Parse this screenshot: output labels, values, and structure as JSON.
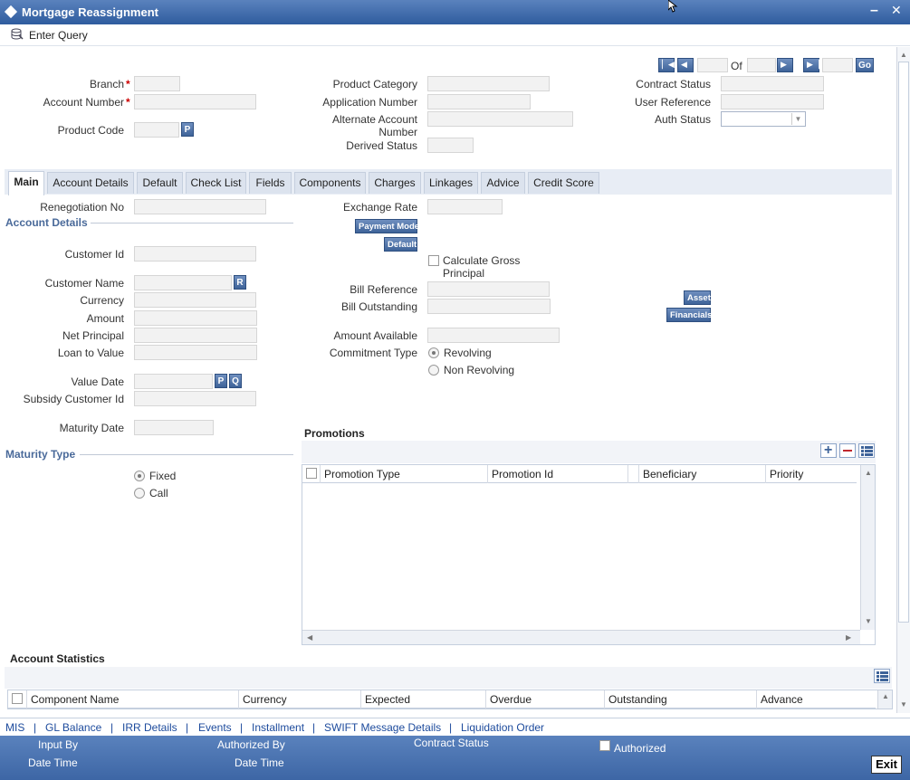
{
  "window": {
    "title": "Mortgage Reassignment",
    "minimize": "–",
    "close": "✕"
  },
  "toolbar": {
    "enter_query": "Enter Query"
  },
  "header": {
    "branch_label": "Branch",
    "account_number_label": "Account Number",
    "product_code_label": "Product Code",
    "product_category_label": "Product Category",
    "application_number_label": "Application Number",
    "alternate_account_label_1": "Alternate Account",
    "alternate_account_label_2": "Number",
    "derived_status_label": "Derived Status",
    "contract_status_label": "Contract Status",
    "user_reference_label": "User Reference",
    "auth_status_label": "Auth Status",
    "nav_of": "Of",
    "go_label": "Go",
    "p_label": "P"
  },
  "tabs": [
    {
      "label": "Main"
    },
    {
      "label": "Account Details"
    },
    {
      "label": "Default"
    },
    {
      "label": "Check List"
    },
    {
      "label": "Fields"
    },
    {
      "label": "Components"
    },
    {
      "label": "Charges"
    },
    {
      "label": "Linkages"
    },
    {
      "label": "Advice"
    },
    {
      "label": "Credit Score"
    }
  ],
  "main": {
    "renegotiation_no_label": "Renegotiation No",
    "account_details_title": "Account Details",
    "customer_id_label": "Customer Id",
    "customer_name_label": "Customer Name",
    "currency_label": "Currency",
    "amount_label": "Amount",
    "net_principal_label": "Net Principal",
    "loan_to_value_label": "Loan to Value",
    "value_date_label": "Value Date",
    "subsidy_customer_id_label": "Subsidy Customer Id",
    "maturity_date_label": "Maturity Date",
    "maturity_type_title": "Maturity Type",
    "fixed_label": "Fixed",
    "call_label": "Call",
    "r_label": "R",
    "p_label": "P",
    "q_label": "Q",
    "exchange_rate_label": "Exchange Rate",
    "payment_mode_button": "Payment Mode",
    "default_button": "Default",
    "calc_gross_1": "Calculate Gross",
    "calc_gross_2": "Principal",
    "bill_reference_label": "Bill Reference",
    "bill_outstanding_label": "Bill Outstanding",
    "amount_available_label": "Amount Available",
    "commitment_type_label": "Commitment Type",
    "revolving_label": "Revolving",
    "non_revolving_label": "Non Revolving",
    "asset_button": "Asset",
    "financials_button": "Financials"
  },
  "promotions": {
    "title": "Promotions",
    "columns": [
      "Promotion Type",
      "Promotion Id",
      "Beneficiary",
      "Priority"
    ]
  },
  "account_statistics": {
    "title": "Account Statistics",
    "columns": [
      "Component Name",
      "Currency",
      "Expected",
      "Overdue",
      "Outstanding",
      "Advance"
    ]
  },
  "bottom_links": [
    "MIS",
    "GL Balance",
    "IRR Details",
    "Events",
    "Installment",
    "SWIFT Message Details",
    "Liquidation Order"
  ],
  "footer": {
    "input_by": "Input By",
    "date_time": "Date Time",
    "authorized_by": "Authorized By",
    "date_time_2": "Date Time",
    "contract_status": "Contract Status",
    "authorized": "Authorized",
    "exit": "Exit"
  }
}
